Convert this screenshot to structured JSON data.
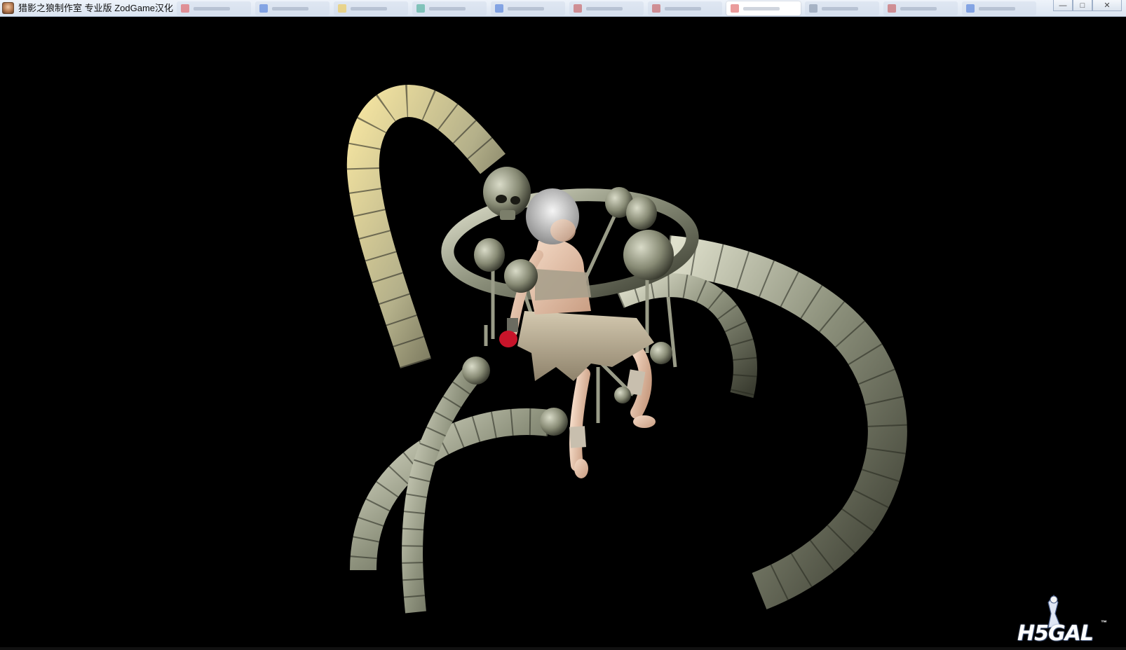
{
  "window": {
    "title": "猎影之狼制作室 专业版 ZodGame汉化",
    "controls": {
      "minimize": "—",
      "maximize": "□",
      "close": "✕"
    }
  },
  "watermark": {
    "text": "H5GAL",
    "tm": "™"
  },
  "colors": {
    "background": "#000000",
    "bone_light": "#c9cbb6",
    "bone_mid": "#7e8270",
    "bone_dark": "#3c3e33",
    "skull": "#8a8c78",
    "hair": "#d6d6d6",
    "skin": "#e9c7ad",
    "cloth": "#b9ad95",
    "glove": "#c8142a"
  },
  "icons": [
    "app-icon",
    "skull-icon",
    "watermark-character-icon"
  ]
}
